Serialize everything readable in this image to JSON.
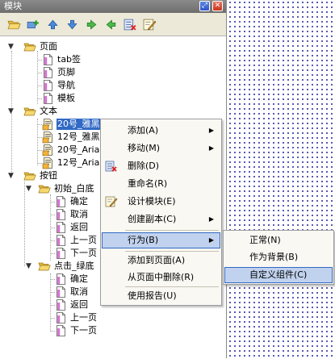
{
  "window": {
    "title": "模块"
  },
  "tree": {
    "pages_folder": "页面",
    "pages": [
      "tab签",
      "页脚",
      "导航",
      "模板"
    ],
    "text_folder": "文本",
    "text_items": [
      "20号_雅黑",
      "12号_雅黑",
      "20号_Arial",
      "12号_Arial"
    ],
    "buttons_folder": "按钮",
    "group1": "初始_白底",
    "group1_items": [
      "确定",
      "取消",
      "返回",
      "上一页",
      "下一页"
    ],
    "group2": "点击_绿底",
    "group2_items": [
      "确定",
      "取消",
      "返回",
      "上一页",
      "下一页"
    ]
  },
  "context_menu": {
    "items": [
      "添加(A)",
      "移动(M)",
      "删除(D)",
      "重命名(R)",
      "设计模块(E)",
      "创建副本(C)",
      "行为(B)",
      "添加到页面(A)",
      "从页面中删除(R)",
      "使用报告(U)"
    ]
  },
  "submenu": {
    "items": [
      "正常(N)",
      "作为背景(B)",
      "自定义组件(C)"
    ]
  },
  "colors": {
    "selection": "#316ac5",
    "menu_highlight": "#c1d2ee",
    "folder": "#f2c94c",
    "page_icon": "#d66fd0"
  }
}
